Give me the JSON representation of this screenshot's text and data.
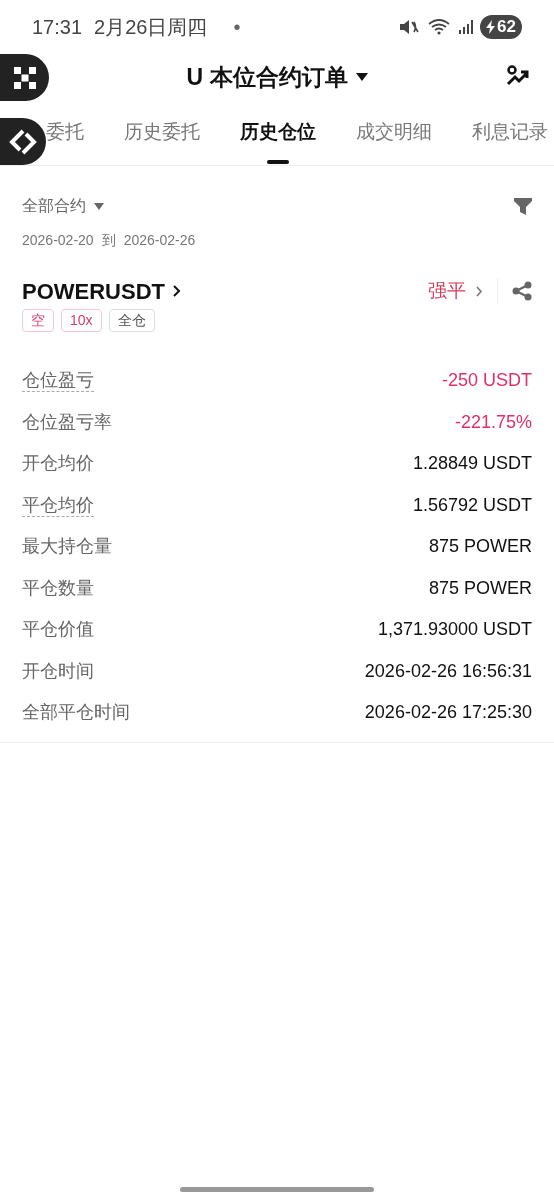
{
  "status_bar": {
    "time": "17:31",
    "date": "2月26日周四",
    "dot": "•",
    "battery": "62"
  },
  "header": {
    "title": "U 本位合约订单"
  },
  "tabs": [
    {
      "label": "委托",
      "selected": false
    },
    {
      "label": "历史委托",
      "selected": false
    },
    {
      "label": "历史仓位",
      "selected": true
    },
    {
      "label": "成交明细",
      "selected": false
    },
    {
      "label": "利息记录",
      "selected": false
    }
  ],
  "filter": {
    "label": "全部合约",
    "date_from": "2026-02-20",
    "date_sep": "到",
    "date_to": "2026-02-26"
  },
  "position": {
    "symbol": "POWERUSDT",
    "status": "强平",
    "tags": [
      {
        "label": "空",
        "kind": "pink"
      },
      {
        "label": "10x",
        "kind": "pink"
      },
      {
        "label": "全仓",
        "kind": "neutral"
      }
    ],
    "rows": [
      {
        "label": "仓位盈亏",
        "value": "-250 USDT",
        "dotted": true,
        "kind": "loss"
      },
      {
        "label": "仓位盈亏率",
        "value": "-221.75%",
        "dotted": false,
        "kind": "loss"
      },
      {
        "label": "开仓均价",
        "value": "1.28849 USDT",
        "dotted": false,
        "kind": "plain"
      },
      {
        "label": "平仓均价",
        "value": "1.56792 USDT",
        "dotted": true,
        "kind": "plain"
      },
      {
        "label": "最大持仓量",
        "value": "875 POWER",
        "dotted": false,
        "kind": "plain"
      },
      {
        "label": "平仓数量",
        "value": "875 POWER",
        "dotted": false,
        "kind": "plain"
      },
      {
        "label": "平仓价值",
        "value": "1,371.93000 USDT",
        "dotted": false,
        "kind": "plain"
      },
      {
        "label": "开仓时间",
        "value": "2026-02-26 16:56:31",
        "dotted": false,
        "kind": "plain"
      },
      {
        "label": "全部平仓时间",
        "value": "2026-02-26 17:25:30",
        "dotted": false,
        "kind": "plain"
      }
    ]
  }
}
